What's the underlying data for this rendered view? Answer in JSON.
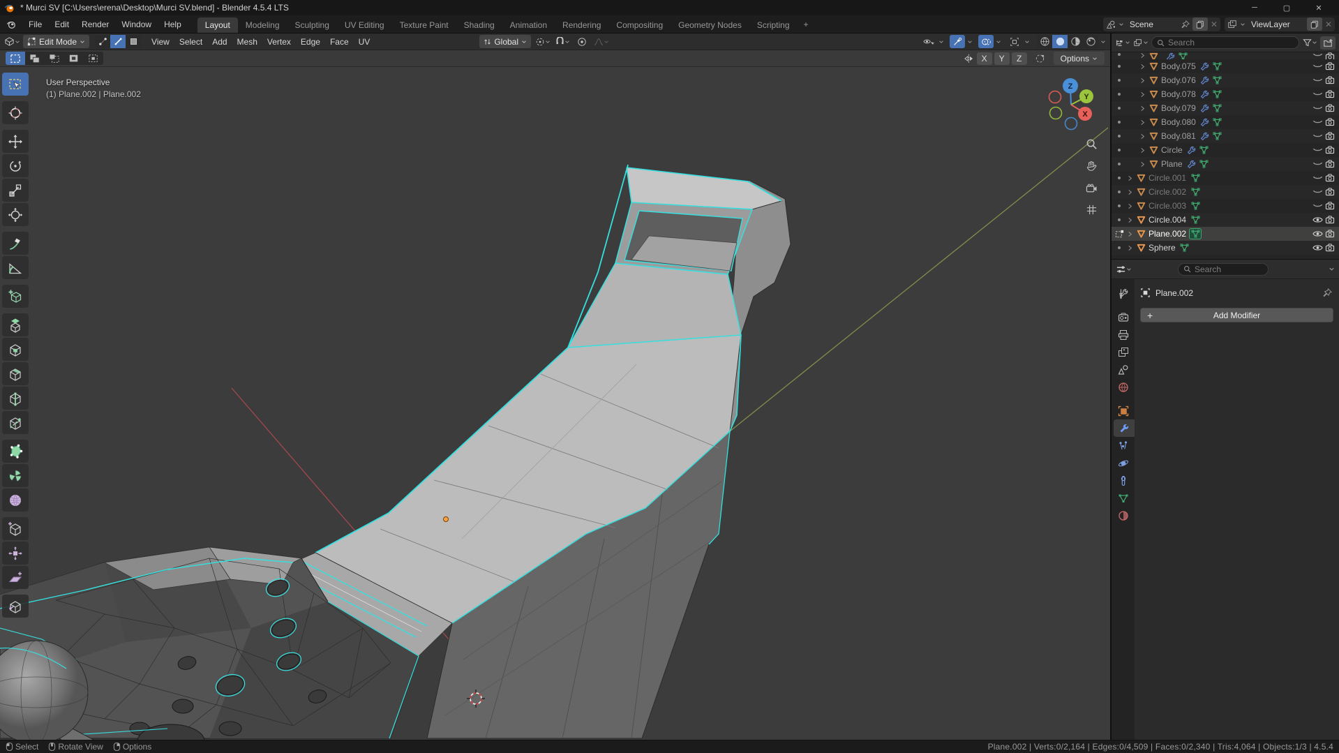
{
  "titlebar": {
    "title": "* Murci SV [C:\\Users\\erena\\Desktop\\Murci SV.blend] - Blender 4.5.4 LTS"
  },
  "menubar": {
    "menus": [
      "File",
      "Edit",
      "Render",
      "Window",
      "Help"
    ],
    "tabs": [
      "Layout",
      "Modeling",
      "Sculpting",
      "UV Editing",
      "Texture Paint",
      "Shading",
      "Animation",
      "Rendering",
      "Compositing",
      "Geometry Nodes",
      "Scripting"
    ],
    "active_tab": "Layout",
    "new_tab_label": "+"
  },
  "scene_bar": {
    "scene": "Scene",
    "view_layer": "ViewLayer"
  },
  "viewport_header": {
    "mode": "Edit Mode",
    "menus": [
      "View",
      "Select",
      "Add",
      "Mesh",
      "Vertex",
      "Edge",
      "Face",
      "UV"
    ],
    "orientation": "Global"
  },
  "tool_settings": {
    "axes": [
      "X",
      "Y",
      "Z"
    ],
    "options_label": "Options"
  },
  "viewport": {
    "view_label": "User Perspective",
    "object_label": "(1) Plane.002 | Plane.002",
    "gizmo_axes": {
      "x": "X",
      "y": "Y",
      "z": "Z"
    }
  },
  "tools": [
    "select-box",
    "cursor",
    "move",
    "rotate",
    "scale",
    "transform",
    "annotate",
    "measure",
    "add-cube",
    "extrude-region",
    "inset-faces",
    "bevel",
    "loop-cut",
    "knife",
    "poly-build",
    "spin",
    "smooth",
    "edge-slide",
    "shrink-fatten",
    "shear",
    "rip-region"
  ],
  "outliner": {
    "search_placeholder": "Search",
    "rows": [
      {
        "name": "",
        "indent": 1,
        "wrench": true,
        "eye": "closed",
        "camera": true,
        "partial": true
      },
      {
        "name": "Body.075",
        "indent": 1,
        "wrench": true,
        "eye": "closed",
        "camera": true
      },
      {
        "name": "Body.076",
        "indent": 1,
        "wrench": true,
        "eye": "closed",
        "camera": true
      },
      {
        "name": "Body.078",
        "indent": 1,
        "wrench": true,
        "eye": "closed",
        "camera": true
      },
      {
        "name": "Body.079",
        "indent": 1,
        "wrench": true,
        "eye": "closed",
        "camera": true
      },
      {
        "name": "Body.080",
        "indent": 1,
        "wrench": true,
        "eye": "closed",
        "camera": true
      },
      {
        "name": "Body.081",
        "indent": 1,
        "wrench": true,
        "eye": "closed",
        "camera": true
      },
      {
        "name": "Circle",
        "indent": 1,
        "wrench": true,
        "eye": "closed",
        "camera": true
      },
      {
        "name": "Plane",
        "indent": 1,
        "wrench": true,
        "eye": "closed",
        "camera": true
      },
      {
        "name": "Circle.001",
        "indent": 0,
        "wrench": false,
        "eye": "closed",
        "camera": true,
        "dim": true
      },
      {
        "name": "Circle.002",
        "indent": 0,
        "wrench": false,
        "eye": "closed",
        "camera": true,
        "dim": true
      },
      {
        "name": "Circle.003",
        "indent": 0,
        "wrench": false,
        "eye": "closed",
        "camera": true,
        "dim": true
      },
      {
        "name": "Circle.004",
        "indent": 0,
        "wrench": false,
        "eye": "open",
        "camera": true
      },
      {
        "name": "Plane.002",
        "indent": 0,
        "wrench": false,
        "eye": "open",
        "camera": true,
        "active": true,
        "edit": true
      },
      {
        "name": "Sphere",
        "indent": 0,
        "wrench": false,
        "eye": "open",
        "camera": true
      }
    ]
  },
  "properties": {
    "search_placeholder": "Search",
    "object_name": "Plane.002",
    "add_modifier_label": "Add Modifier",
    "tabs": [
      "tool",
      "render",
      "output",
      "view-layer",
      "scene",
      "world",
      "object",
      "modifiers",
      "particles",
      "physics",
      "constraints",
      "object-data",
      "material"
    ],
    "active_tab": "modifiers"
  },
  "statusbar": {
    "hints": [
      {
        "button": "left",
        "label": "Select"
      },
      {
        "button": "middle",
        "label": "Rotate View"
      },
      {
        "button": "right",
        "label": "Options"
      }
    ],
    "stats": "Plane.002 | Verts:0/2,164 | Edges:0/4,509 | Faces:0/2,340 | Tris:4,064 | Objects:1/3 | 4.5.4"
  },
  "colors": {
    "accent": "#4772b3",
    "selected_edge": "#35e0e0",
    "object_orange": "#e8883a",
    "mesh_green": "#3fa66f",
    "modifier_blue": "#6f9bf5"
  }
}
